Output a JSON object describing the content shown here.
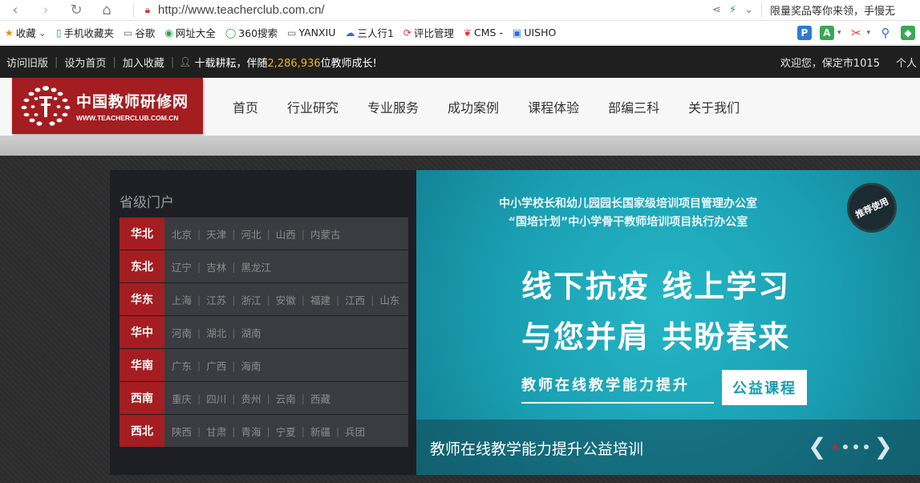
{
  "browser": {
    "url": "http://www.teacherclub.com.cn/",
    "promo_text": "限量奖品等你来领，手慢无"
  },
  "bookmarks": {
    "items": [
      {
        "label": "收藏",
        "icon": "star-icon"
      },
      {
        "label": "手机收藏夹",
        "icon": "phone-icon"
      },
      {
        "label": "谷歌",
        "icon": "page-icon"
      },
      {
        "label": "网址大全",
        "icon": "globe-icon"
      },
      {
        "label": "360搜索",
        "icon": "search360-icon"
      },
      {
        "label": "YANXIU",
        "icon": "page-icon"
      },
      {
        "label": "三人行1",
        "icon": "cloud-icon"
      },
      {
        "label": "评比管理",
        "icon": "refresh-icon"
      },
      {
        "label": "CMS -",
        "icon": "leaf-icon"
      },
      {
        "label": "UISHO",
        "icon": "window-icon"
      }
    ]
  },
  "topbar": {
    "old_version": "访问旧版",
    "set_home": "设为首页",
    "add_fav": "加入收藏",
    "slogan_pre": "十载耕耘，伴随",
    "teacher_count": "2,286,936",
    "slogan_post": "位教师成长!",
    "welcome": "欢迎您，保定市1015",
    "personal": "个人"
  },
  "logo": {
    "cn": "中国教师研修网",
    "en": "WWW.TEACHERCLUB.COM.CN"
  },
  "nav": [
    "首页",
    "行业研究",
    "专业服务",
    "成功案例",
    "课程体验",
    "部编三科",
    "关于我们"
  ],
  "portal": {
    "title": "省级门户",
    "regions": [
      {
        "name": "华北",
        "provinces": [
          "北京",
          "天津",
          "河北",
          "山西",
          "内蒙古"
        ]
      },
      {
        "name": "东北",
        "provinces": [
          "辽宁",
          "吉林",
          "黑龙江"
        ]
      },
      {
        "name": "华东",
        "provinces": [
          "上海",
          "江苏",
          "浙江",
          "安徽",
          "福建",
          "江西",
          "山东"
        ]
      },
      {
        "name": "华中",
        "provinces": [
          "河南",
          "湖北",
          "湖南"
        ]
      },
      {
        "name": "华南",
        "provinces": [
          "广东",
          "广西",
          "海南"
        ]
      },
      {
        "name": "西南",
        "provinces": [
          "重庆",
          "四川",
          "贵州",
          "云南",
          "西藏"
        ]
      },
      {
        "name": "西北",
        "provinces": [
          "陕西",
          "甘肃",
          "青海",
          "宁夏",
          "新疆",
          "兵团"
        ]
      }
    ]
  },
  "banner": {
    "line1": "中小学校长和幼儿园园长国家级培训项目管理办公室",
    "line2": "“国培计划”中小学骨干教师培训项目执行办公室",
    "badge": "推荐使用",
    "big1": "线下抗疫 线上学习",
    "big2": "与您并肩 共盼春来",
    "sub": "教师在线教学能力提升",
    "tag": "公益课程",
    "caption": "教师在线教学能力提升公益培训"
  },
  "colors": {
    "brand_red": "#a41d21",
    "banner_teal": "#1ba6b9",
    "count_gold": "#f0b41c"
  }
}
